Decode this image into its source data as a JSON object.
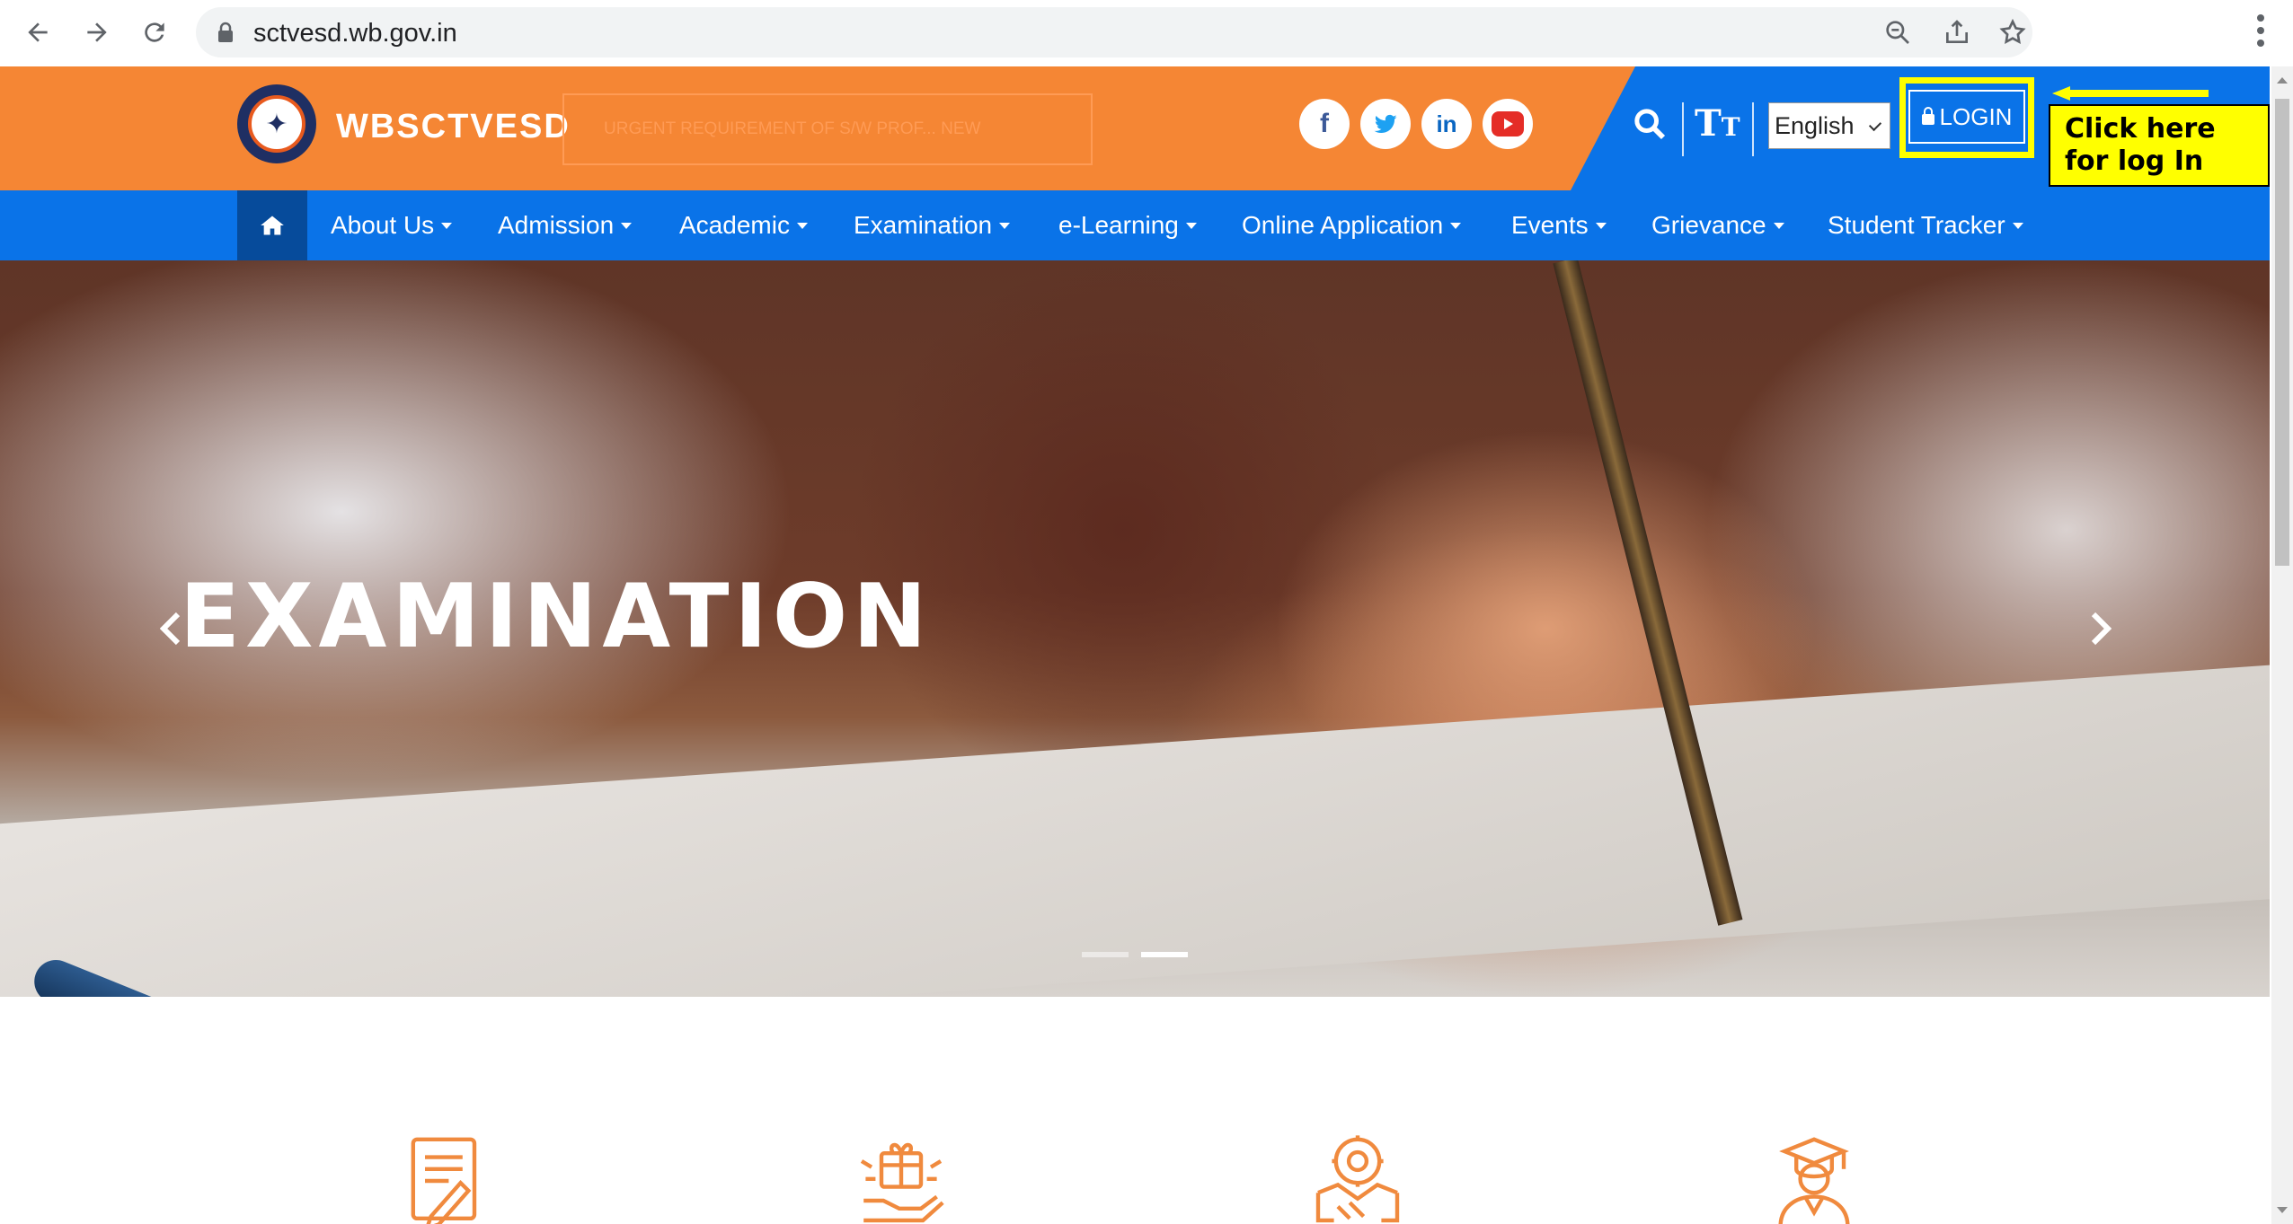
{
  "browser": {
    "url": "sctvesd.wb.gov.in",
    "icons": [
      "back-icon",
      "forward-icon",
      "reload-icon",
      "lock-icon",
      "zoom-icon",
      "share-icon",
      "star-icon",
      "kebab-menu-icon"
    ]
  },
  "header": {
    "brand": "WBSCTVESD",
    "ticker_text": "URGENT REQUIREMENT OF S/W PROF... NEW",
    "social": [
      {
        "name": "facebook-icon",
        "glyph": "f",
        "color": "#3b5998"
      },
      {
        "name": "twitter-icon",
        "glyph": "t",
        "color": "#1da1f2"
      },
      {
        "name": "linkedin-icon",
        "glyph": "in",
        "color": "#0a66c2"
      },
      {
        "name": "youtube-icon",
        "glyph": "▶",
        "color": "#e52d27"
      }
    ],
    "text_size_big": "T",
    "text_size_small": "T",
    "language": "English",
    "login_label": "LOGIN"
  },
  "annotation": {
    "callout_text": "Click here for log In"
  },
  "menu": {
    "items": [
      {
        "label": "About Us"
      },
      {
        "label": "Admission"
      },
      {
        "label": "Academic"
      },
      {
        "label": "Examination"
      },
      {
        "label": "e-Learning"
      },
      {
        "label": "Online Application"
      },
      {
        "label": "Events"
      },
      {
        "label": "Grievance"
      },
      {
        "label": "Student Tracker"
      }
    ]
  },
  "hero": {
    "title": "EXAMINATION",
    "slides": 2,
    "active_slide": 2
  },
  "features": {
    "icons": [
      "exam-sheet-icon",
      "gift-hand-icon",
      "handshake-gear-icon",
      "graduate-icon"
    ]
  },
  "colors": {
    "orange": "#f58634",
    "blue": "#0a73e8",
    "dark_blue": "#064b9b",
    "highlight": "#ffff00",
    "feature_icon": "#f08a3e"
  }
}
